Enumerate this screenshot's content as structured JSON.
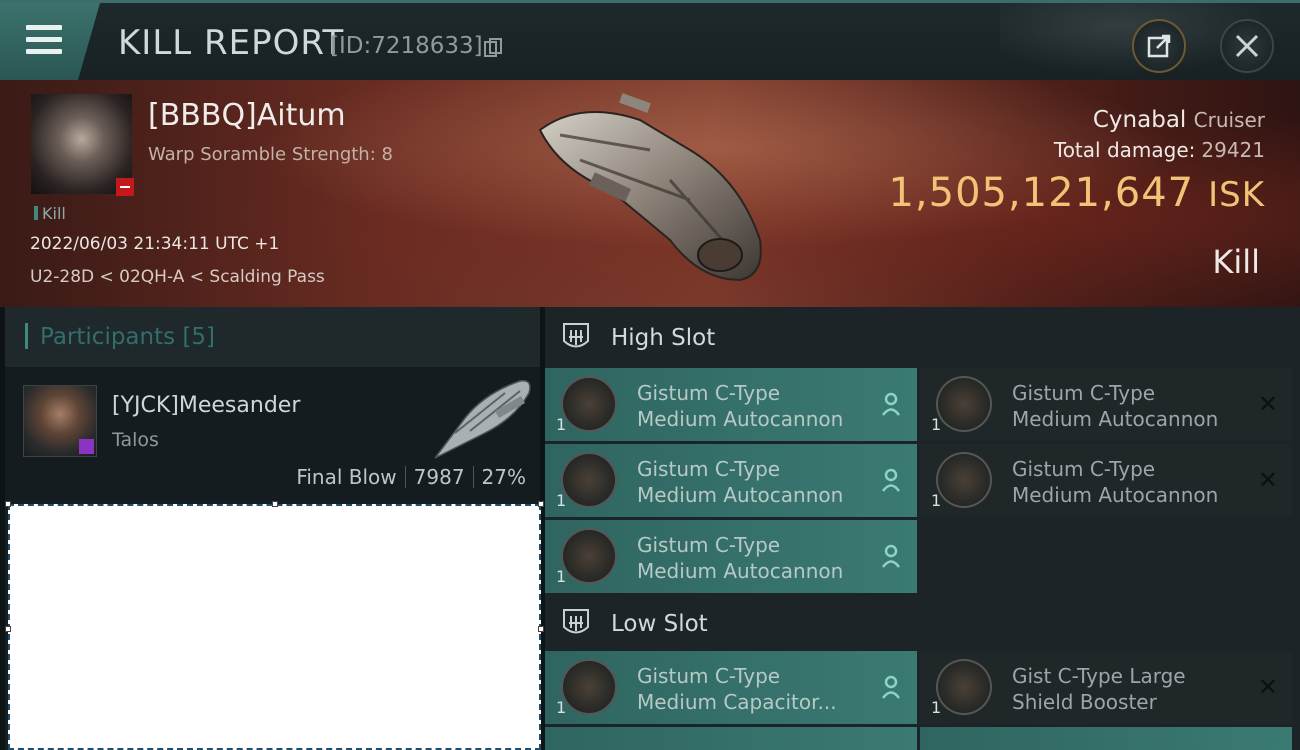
{
  "header": {
    "title": "KILL REPORT",
    "report_id": "[ID:7218633]"
  },
  "victim": {
    "name": "[BBBQ]Aitum",
    "warp_scramble": "Warp Soramble Strength: 8",
    "kill_tag": "Kill",
    "datetime": "2022/06/03 21:34:11 UTC +1",
    "location": "U2-28D < 02QH-A < Scalding Pass",
    "ship_name": "Cynabal",
    "ship_class": "Cruiser",
    "total_damage_label": "Total damage:",
    "total_damage_value": "29421",
    "isk_value": "1,505,121,647",
    "isk_unit": "ISK",
    "result": "Kill"
  },
  "participants": {
    "title": "Participants",
    "count": "[5]",
    "items": [
      {
        "name": "[YJCK]Meesander",
        "ship": "Talos",
        "final_blow": "Final Blow",
        "damage": "7987",
        "percent": "27%"
      }
    ]
  },
  "slots": {
    "high": {
      "title": "High Slot",
      "modules": [
        {
          "line1": "Gistum C-Type",
          "line2": "Medium Autocannon",
          "qty": "1",
          "state": "dropped"
        },
        {
          "line1": "Gistum C-Type",
          "line2": "Medium Autocannon",
          "qty": "1",
          "state": "destroyed"
        },
        {
          "line1": "Gistum C-Type",
          "line2": "Medium Autocannon",
          "qty": "1",
          "state": "dropped"
        },
        {
          "line1": "Gistum C-Type",
          "line2": "Medium Autocannon",
          "qty": "1",
          "state": "destroyed"
        },
        {
          "line1": "Gistum C-Type",
          "line2": "Medium Autocannon",
          "qty": "1",
          "state": "dropped"
        }
      ]
    },
    "low": {
      "title": "Low Slot",
      "modules": [
        {
          "line1": "Gistum C-Type",
          "line2": "Medium Capacitor...",
          "qty": "1",
          "state": "dropped"
        },
        {
          "line1": "Gist C-Type Large",
          "line2": "Shield Booster",
          "qty": "1",
          "state": "destroyed"
        }
      ]
    }
  },
  "colors": {
    "accent_teal": "#3b7a73",
    "isk_gold": "#f2c377",
    "loss_red": "#c4191b"
  },
  "icons": {
    "menu": "hamburger-icon",
    "copy": "copy-icon",
    "share": "share-icon",
    "close": "close-icon",
    "slot": "slot-rack-icon",
    "dropped": "person-icon",
    "destroyed": "x-icon"
  }
}
